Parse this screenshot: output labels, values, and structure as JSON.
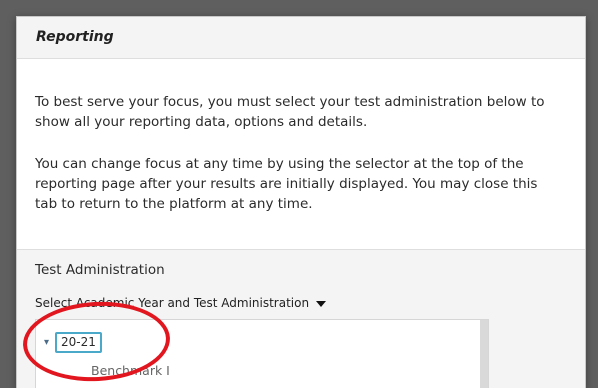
{
  "panel": {
    "title": "Reporting",
    "paragraph_1": "To best serve your focus, you must select your test administration below to show all your reporting data, options and details.",
    "paragraph_2": "You can change focus at any time by using the selector at the top of the reporting page after your results are initially displayed. You may close this tab to return to the platform at any time."
  },
  "test_administration": {
    "label": "Test Administration",
    "selector_text": "Select Academic Year and Test Administration",
    "tree": {
      "expander_icon": "▾",
      "year": "20-21",
      "child": "Benchmark I"
    }
  },
  "annotation": {
    "circle_color": "#e1161f"
  },
  "colors": {
    "accent_border": "#4aa8c8",
    "overlay_background": "#5f5f5f"
  }
}
